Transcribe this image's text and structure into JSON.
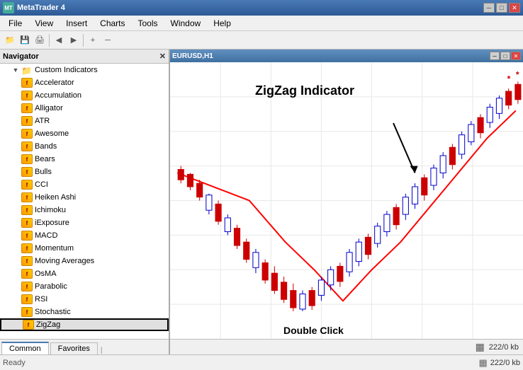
{
  "titleBar": {
    "title": "MetaTrader 4",
    "icon": "MT",
    "controls": {
      "minimize": "─",
      "maximize": "□",
      "close": "✕"
    }
  },
  "menuBar": {
    "items": [
      "File",
      "View",
      "Insert",
      "Charts",
      "Tools",
      "Window",
      "Help"
    ]
  },
  "navigator": {
    "title": "Navigator",
    "closeBtn": "✕",
    "tree": {
      "root": {
        "label": "Custom Indicators",
        "expanded": true
      },
      "items": [
        "Accelerator",
        "Accumulation",
        "Alligator",
        "ATR",
        "Awesome",
        "Bands",
        "Bears",
        "Bulls",
        "CCI",
        "Heiken Ashi",
        "Ichimoku",
        "iExposure",
        "MACD",
        "Momentum",
        "Moving Averages",
        "OsMA",
        "Parabolic",
        "RSI",
        "Stochastic",
        "ZigZag"
      ],
      "selected": "ZigZag"
    },
    "tabs": [
      {
        "label": "Common",
        "active": true
      },
      {
        "label": "Favorites",
        "active": false
      }
    ]
  },
  "chart": {
    "innerWindowTitle": "EURUSD,H1",
    "annotation": "ZigZag Indicator",
    "doubleClickLabel": "Double Click",
    "statusBar": {
      "gridIcon": "▦",
      "info": "222/0 kb"
    }
  }
}
